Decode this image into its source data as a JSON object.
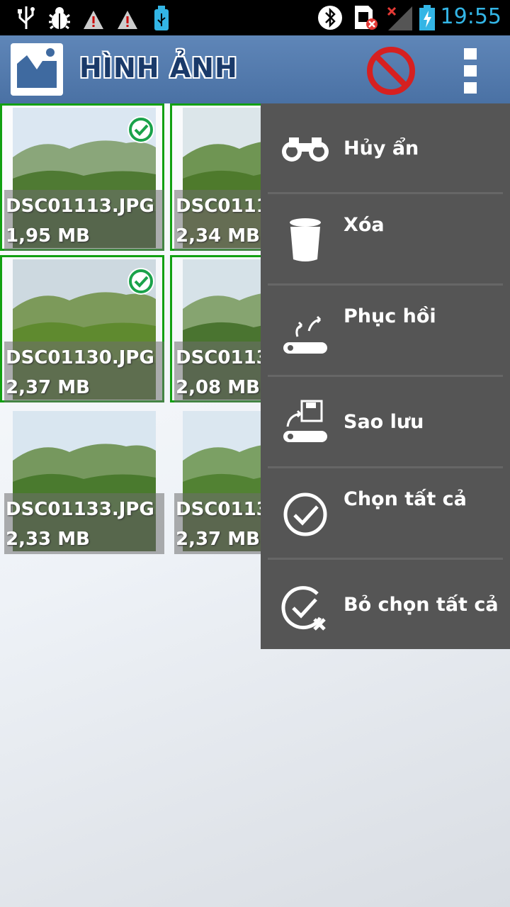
{
  "status_bar": {
    "time": "19:55",
    "icons": [
      "usb-icon",
      "bug-icon",
      "warning-icon",
      "warning-icon",
      "usb-storage-icon",
      "bluetooth-icon",
      "sim-error-icon",
      "signal-no-service-icon",
      "battery-charging-icon"
    ],
    "time_color": "#33b5e5"
  },
  "action_bar": {
    "title": "HÌNH ẢNH",
    "icons": [
      "gallery-icon",
      "block-icon",
      "overflow-menu-icon"
    ]
  },
  "photos": [
    {
      "name": "DSC01113.JPG",
      "size": "1,95 MB",
      "selected": true
    },
    {
      "name": "DSC0111",
      "size": "2,34 MB",
      "selected": true
    },
    {
      "name": "DSC01130.JPG",
      "size": "2,37 MB",
      "selected": true
    },
    {
      "name": "DSC0113",
      "size": "2,08 MB",
      "selected": true
    },
    {
      "name": "DSC01133.JPG",
      "size": "2,33 MB",
      "selected": false
    },
    {
      "name": "DSC0113",
      "size": "2,37 MB",
      "selected": false
    }
  ],
  "menu": {
    "items": [
      {
        "label": "Hủy ẩn",
        "icon": "binoculars-icon"
      },
      {
        "label": "Xóa",
        "icon": "trash-icon"
      },
      {
        "label": "Phục hồi",
        "icon": "restore-icon"
      },
      {
        "label": "Sao lưu",
        "icon": "backup-icon"
      },
      {
        "label": "Chọn tất cả",
        "icon": "check-circle-icon"
      },
      {
        "label": "Bỏ chọn tất cả",
        "icon": "uncheck-circle-icon"
      }
    ]
  },
  "colors": {
    "action_bar": "#5a80b2",
    "selection": "#12a012",
    "menu_bg": "#555555",
    "title": "#1a3a6a"
  }
}
